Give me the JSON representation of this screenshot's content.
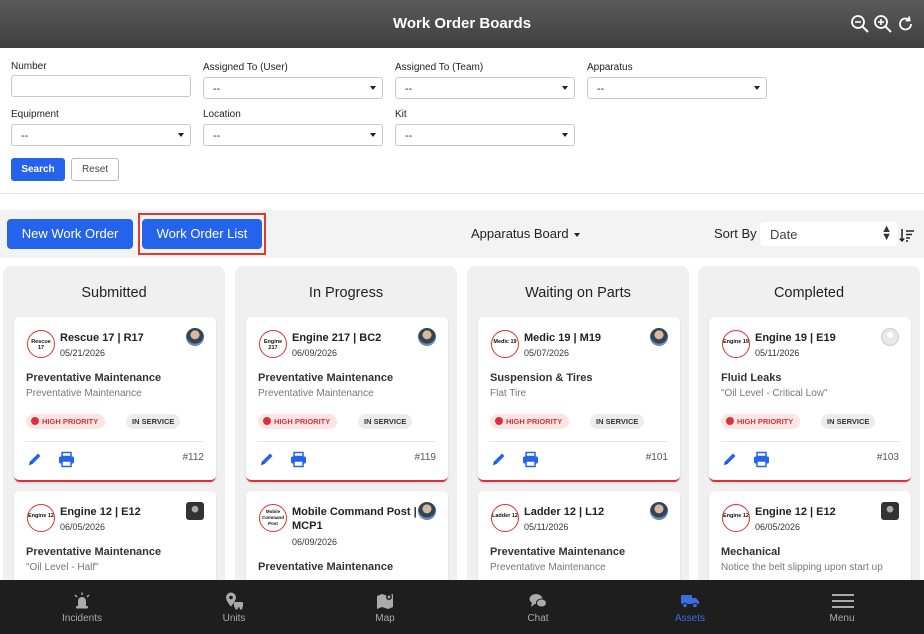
{
  "header": {
    "title": "Work Order Boards",
    "icons": [
      "zoom-out-icon",
      "zoom-in-icon",
      "refresh-icon"
    ]
  },
  "filters": {
    "number_label": "Number",
    "number_value": "",
    "assigned_user_label": "Assigned To (User)",
    "assigned_user_value": "--",
    "assigned_team_label": "Assigned To (Team)",
    "assigned_team_value": "--",
    "apparatus_label": "Apparatus",
    "apparatus_value": "--",
    "equipment_label": "Equipment",
    "equipment_value": "--",
    "location_label": "Location",
    "location_value": "--",
    "kit_label": "Kit",
    "kit_value": "--",
    "search_label": "Search",
    "reset_label": "Reset"
  },
  "toolbar": {
    "new_work_order_label": "New Work Order",
    "work_order_list_label": "Work Order List",
    "board_label": "Apparatus Board",
    "sort_label": "Sort By",
    "sort_value": "Date"
  },
  "columns": [
    {
      "title": "Submitted",
      "cards": [
        {
          "badge": "Rescue 17",
          "title": "Rescue 17 | R17",
          "date": "05/21/2026",
          "type": "Preventative Maintenance",
          "desc": "Preventative Maintenance",
          "priority": "HIGH PRIORITY",
          "service": "IN SERVICE",
          "number": "#112"
        },
        {
          "badge": "Engine 12",
          "title": "Engine 12 | E12",
          "date": "06/05/2026",
          "type": "Preventative Maintenance",
          "desc": "\"Oil Level - Half\""
        }
      ]
    },
    {
      "title": "In Progress",
      "cards": [
        {
          "badge": "Engine 217",
          "title": "Engine 217 | BC2",
          "date": "06/09/2026",
          "type": "Preventative Maintenance",
          "desc": "Preventative Maintenance",
          "priority": "HIGH PRIORITY",
          "service": "IN SERVICE",
          "number": "#119"
        },
        {
          "badge": "Mobile Command Post",
          "title": "Mobile Command Post | MCP1",
          "date": "06/09/2026",
          "type": "Preventative Maintenance",
          "desc": ""
        }
      ]
    },
    {
      "title": "Waiting on Parts",
      "cards": [
        {
          "badge": "Medic 19",
          "title": "Medic 19 | M19",
          "date": "05/07/2026",
          "type": "Suspension & Tires",
          "desc": "Flat Tire",
          "priority": "HIGH PRIORITY",
          "service": "IN SERVICE",
          "number": "#101"
        },
        {
          "badge": "Ladder 12",
          "title": "Ladder 12 | L12",
          "date": "05/11/2026",
          "type": "Preventative Maintenance",
          "desc": "Preventative Maintenance"
        }
      ]
    },
    {
      "title": "Completed",
      "cards": [
        {
          "badge": "Engine 19",
          "title": "Engine 19 | E19",
          "date": "05/11/2026",
          "type": "Fluid Leaks",
          "desc": "\"Oil Level - Critical Low\"",
          "priority": "HIGH PRIORITY",
          "service": "IN SERVICE",
          "number": "#103"
        },
        {
          "badge": "Engine 12",
          "title": "Engine 12 | E12",
          "date": "06/05/2026",
          "type": "Mechanical",
          "desc": "Notice the belt slipping upon start up"
        }
      ]
    }
  ],
  "bottom_nav": [
    {
      "label": "Incidents",
      "icon": "alarm-icon"
    },
    {
      "label": "Units",
      "icon": "units-icon"
    },
    {
      "label": "Map",
      "icon": "map-icon"
    },
    {
      "label": "Chat",
      "icon": "chat-icon"
    },
    {
      "label": "Assets",
      "icon": "truck-icon",
      "active": true
    },
    {
      "label": "Menu",
      "icon": "menu-icon"
    }
  ],
  "colors": {
    "accent": "#2563eb",
    "priority": "#d8323e",
    "highlight_box": "#e03b2f",
    "nav_bg": "#1e1e1e",
    "nav_active": "#3b6fe0"
  }
}
